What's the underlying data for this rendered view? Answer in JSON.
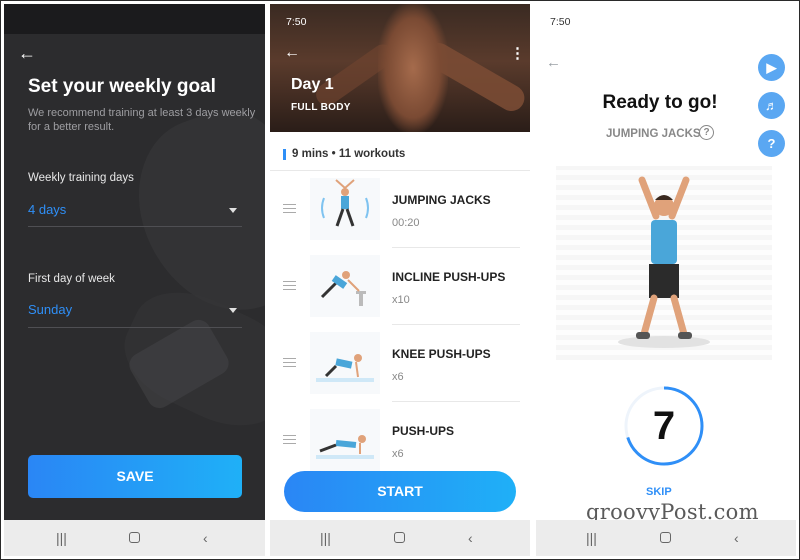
{
  "goal_screen": {
    "title": "Set your weekly goal",
    "subtitle": "We recommend training at least 3 days weekly for a better result.",
    "training_days_label": "Weekly training days",
    "training_days_value": "4 days",
    "first_day_label": "First day of week",
    "first_day_value": "Sunday",
    "save_label": "SAVE",
    "icons": {
      "back": "back-arrow-icon",
      "dropdown": "caret-down-icon"
    }
  },
  "workout_screen": {
    "status_time": "7:50",
    "day_title": "Day 1",
    "category": "FULL BODY",
    "summary": "9 mins • 11 workouts",
    "exercises": [
      {
        "name": "JUMPING JACKS",
        "qty": "00:20"
      },
      {
        "name": "INCLINE PUSH-UPS",
        "qty": "x10"
      },
      {
        "name": "KNEE PUSH-UPS",
        "qty": "x6"
      },
      {
        "name": "PUSH-UPS",
        "qty": "x6"
      }
    ],
    "start_label": "START",
    "icons": {
      "back": "back-arrow-icon",
      "menu": "more-vertical-icon",
      "drag": "drag-handle-icon"
    }
  },
  "ready_screen": {
    "status_time": "7:50",
    "title": "Ready to go!",
    "exercise_name": "JUMPING JACKS",
    "countdown": "7",
    "countdown_progress": 0.7,
    "skip_label": "SKIP",
    "watermark": "groovyPost.com",
    "icons": {
      "back": "back-arrow-icon",
      "video": "video-icon",
      "sound": "volume-icon",
      "help": "help-icon"
    }
  },
  "navbar": {
    "icons": [
      "recent-apps-icon",
      "home-icon",
      "back-icon"
    ]
  },
  "colors": {
    "accent": "#2f8ff7",
    "dark_bg": "#2c2c2e"
  }
}
